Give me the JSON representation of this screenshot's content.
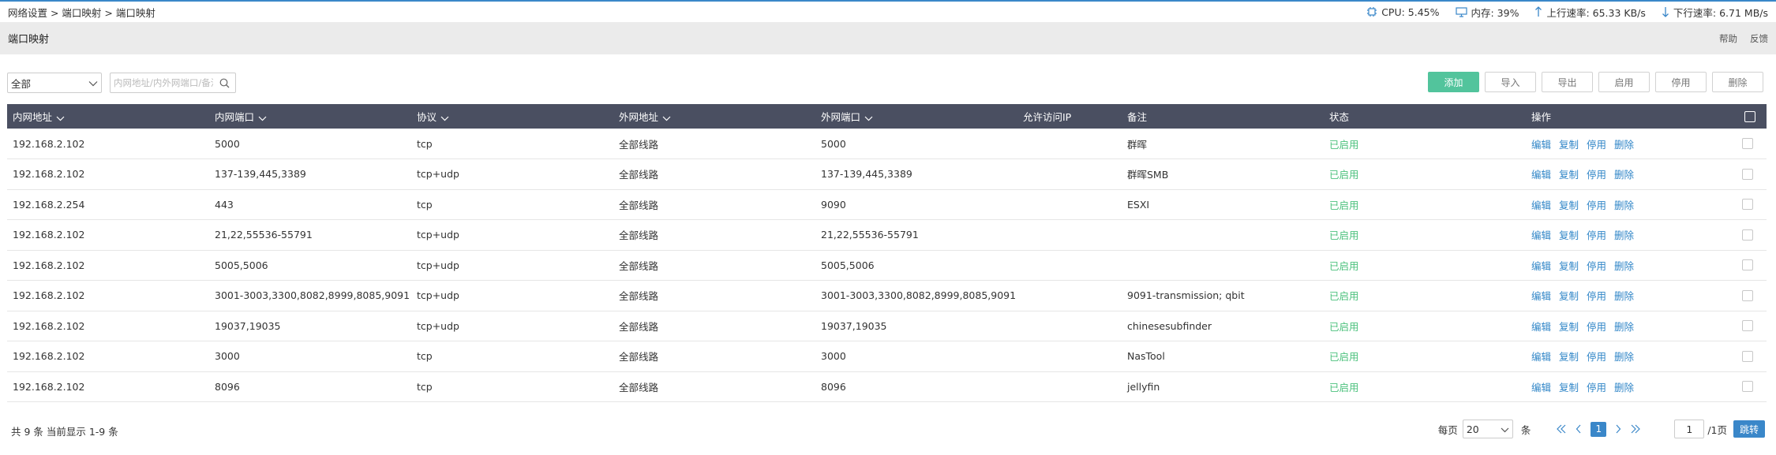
{
  "breadcrumb": "网络设置 > 端口映射 > 端口映射",
  "stats": {
    "cpu": "CPU: 5.45%",
    "mem": "内存: 39%",
    "up": "上行速率: 65.33 KB/s",
    "down": "下行速率: 6.71 MB/s"
  },
  "header": {
    "title": "端口映射",
    "help": "帮助",
    "feedback": "反馈"
  },
  "filter": {
    "value": "全部",
    "search_placeholder": "内网地址/内外网端口/备注"
  },
  "buttons": {
    "add": "添加",
    "import": "导入",
    "export": "导出",
    "enable": "启用",
    "disable": "停用",
    "delete": "删除"
  },
  "table": {
    "columns": [
      "内网地址",
      "内网端口",
      "协议",
      "外网地址",
      "外网端口",
      "允许访问IP",
      "备注",
      "状态",
      "操作"
    ],
    "actions": [
      "编辑",
      "复制",
      "停用",
      "删除"
    ],
    "rows": [
      {
        "ip": "192.168.2.102",
        "lport": "5000",
        "proto": "tcp",
        "waddr": "全部线路",
        "wport": "5000",
        "allow": "",
        "note": "群晖",
        "status": "已启用"
      },
      {
        "ip": "192.168.2.102",
        "lport": "137-139,445,3389",
        "proto": "tcp+udp",
        "waddr": "全部线路",
        "wport": "137-139,445,3389",
        "allow": "",
        "note": "群晖SMB",
        "status": "已启用"
      },
      {
        "ip": "192.168.2.254",
        "lport": "443",
        "proto": "tcp",
        "waddr": "全部线路",
        "wport": "9090",
        "allow": "",
        "note": "ESXI",
        "status": "已启用"
      },
      {
        "ip": "192.168.2.102",
        "lport": "21,22,55536-55791",
        "proto": "tcp+udp",
        "waddr": "全部线路",
        "wport": "21,22,55536-55791",
        "allow": "",
        "note": "",
        "status": "已启用"
      },
      {
        "ip": "192.168.2.102",
        "lport": "5005,5006",
        "proto": "tcp+udp",
        "waddr": "全部线路",
        "wport": "5005,5006",
        "allow": "",
        "note": "",
        "status": "已启用"
      },
      {
        "ip": "192.168.2.102",
        "lport": "3001-3003,3300,8082,8999,8085,9091",
        "proto": "tcp+udp",
        "waddr": "全部线路",
        "wport": "3001-3003,3300,8082,8999,8085,9091",
        "allow": "",
        "note": "9091-transmission; qbit",
        "status": "已启用"
      },
      {
        "ip": "192.168.2.102",
        "lport": "19037,19035",
        "proto": "tcp+udp",
        "waddr": "全部线路",
        "wport": "19037,19035",
        "allow": "",
        "note": "chinesesubfinder",
        "status": "已启用"
      },
      {
        "ip": "192.168.2.102",
        "lport": "3000",
        "proto": "tcp",
        "waddr": "全部线路",
        "wport": "3000",
        "allow": "",
        "note": "NasTool",
        "status": "已启用"
      },
      {
        "ip": "192.168.2.102",
        "lport": "8096",
        "proto": "tcp",
        "waddr": "全部线路",
        "wport": "8096",
        "allow": "",
        "note": "jellyfin",
        "status": "已启用"
      }
    ]
  },
  "footer": {
    "summary": "共 9 条 当前显示 1-9 条",
    "per_page_label": "每页",
    "per_page_value": "20",
    "per_page_unit": "条",
    "current_page": "1",
    "page_input": "1",
    "page_total": "/1页",
    "go": "跳转"
  },
  "colors": {
    "accent": "#3a87c9",
    "add_button": "#52c49c",
    "header_bg": "#4a4f61",
    "status_on": "#4cc17d",
    "action": "#2f85c7"
  }
}
